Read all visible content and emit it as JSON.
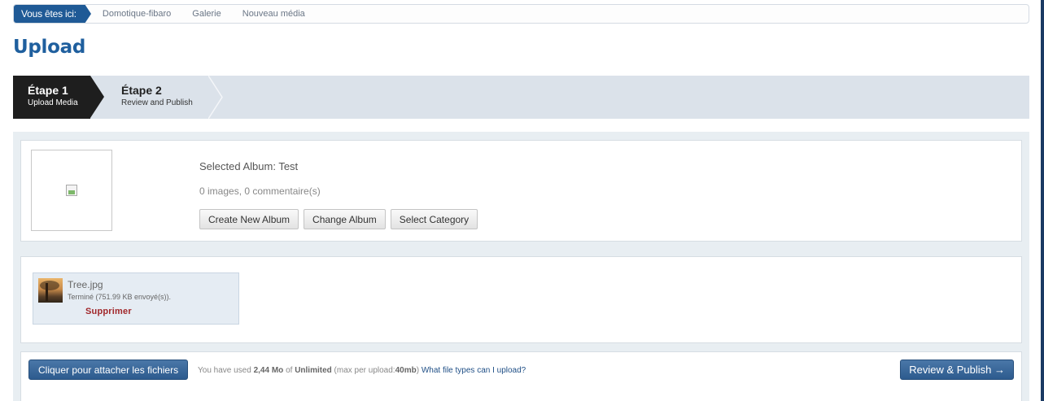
{
  "breadcrumb": {
    "here": "Vous êtes ici:",
    "items": [
      "Domotique-fibaro",
      "Galerie",
      "Nouveau média"
    ]
  },
  "page_title": "Upload",
  "steps": [
    {
      "title": "Étape 1",
      "subtitle": "Upload Media",
      "active": true
    },
    {
      "title": "Étape 2",
      "subtitle": "Review and Publish",
      "active": false
    }
  ],
  "album": {
    "selected": "Selected Album: Test",
    "count": "0 images, 0 commentaire(s)",
    "buttons": {
      "create": "Create New Album",
      "change": "Change Album",
      "category": "Select Category"
    }
  },
  "file": {
    "name": "Tree.jpg",
    "status": "Terminé (751.99 KB envoyé(s)).",
    "delete": "Supprimer"
  },
  "actions": {
    "attach": "Cliquer pour attacher les fichiers",
    "usage_prefix": "You have used",
    "used": "2,44 Mo",
    "of": "of",
    "limit": "Unlimited",
    "max_prefix": "(max per upload:",
    "max": "40mb",
    "max_suffix": ")",
    "help_link": "What file types can I upload?",
    "publish": "Review & Publish →"
  },
  "colors": {
    "accent": "#1f5a96",
    "title": "#1f5f9e",
    "delete": "#a1272a"
  }
}
